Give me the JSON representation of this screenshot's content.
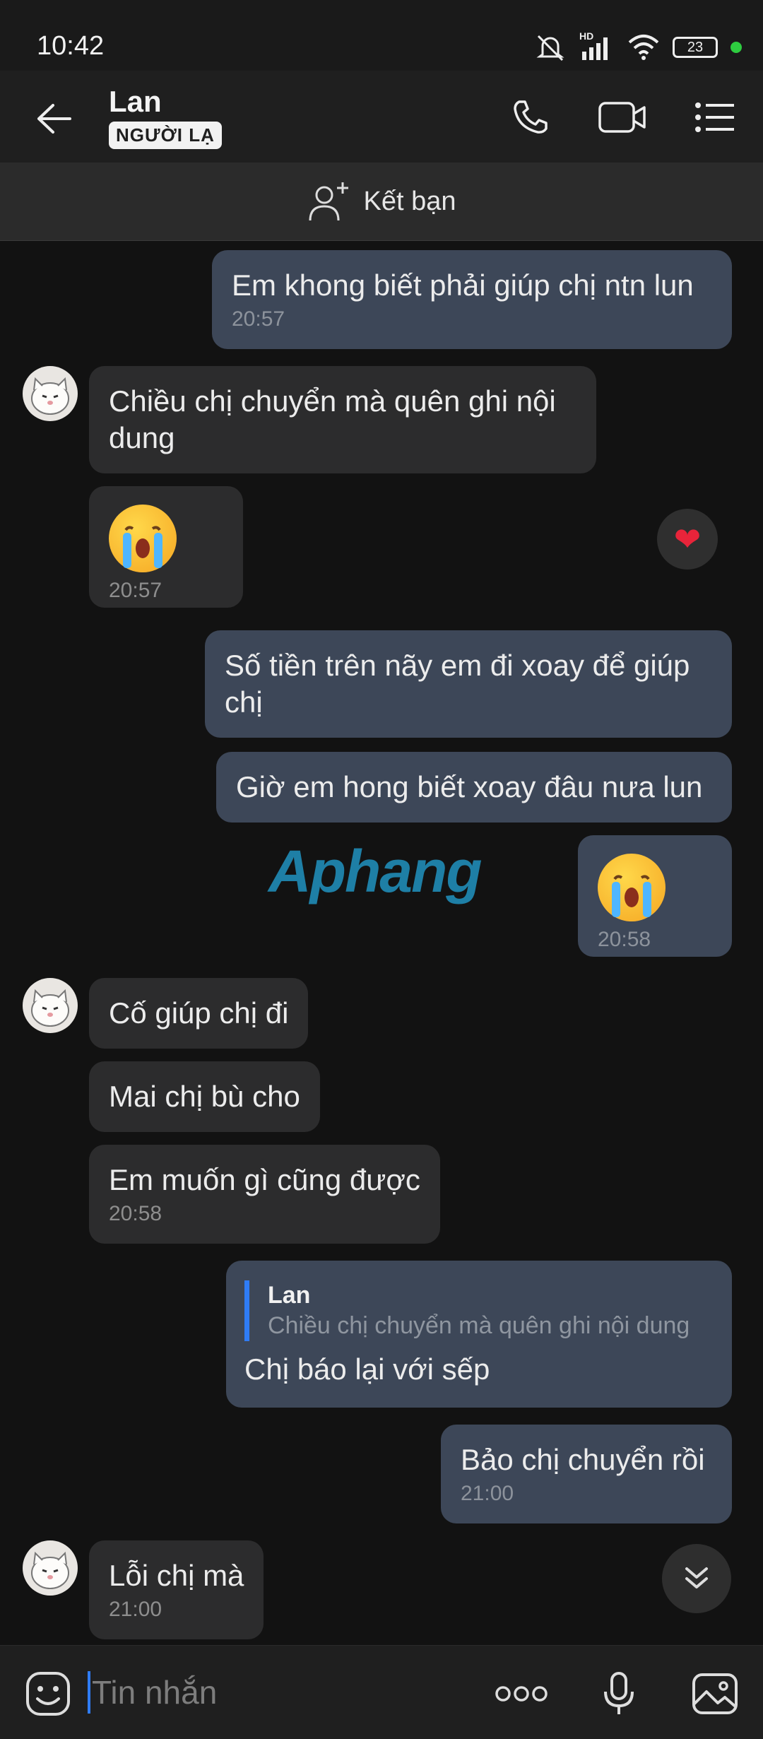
{
  "status_bar": {
    "time": "10:42",
    "network": "HD",
    "battery": "23"
  },
  "header": {
    "name": "Lan",
    "badge": "NGƯỜI LẠ"
  },
  "friend_bar": {
    "label": "Kết bạn"
  },
  "watermark": {
    "text": "Aphang"
  },
  "messages": {
    "m1": {
      "text": "Em khong biết phải giúp chị ntn lun",
      "time": "20:57"
    },
    "m2": {
      "text": "Chiều chị chuyển mà quên ghi nội dung"
    },
    "m3": {
      "time": "20:57",
      "reaction": "❤"
    },
    "m4": {
      "text": "Số tiền trên nãy em đi xoay để giúp chị"
    },
    "m5": {
      "text": "Giờ em hong biết xoay đâu nưa lun"
    },
    "m6": {
      "time": "20:58"
    },
    "m7": {
      "text": "Cố giúp chị đi"
    },
    "m8": {
      "text": "Mai chị bù cho"
    },
    "m9": {
      "text": "Em muốn gì cũng được",
      "time": "20:58"
    },
    "m10": {
      "quote_name": "Lan",
      "quote_text": "Chiều chị chuyển mà quên ghi nội dung",
      "text": "Chị báo lại với sếp"
    },
    "m11": {
      "text": "Bảo chị chuyển rồi",
      "time": "21:00"
    },
    "m12": {
      "text": "Lỗi chị mà",
      "time": "21:00"
    }
  },
  "composer": {
    "placeholder": "Tin nhắn"
  },
  "colors": {
    "accent": "#2f7cf6",
    "sent_bubble": "#3d4758",
    "received_bubble": "#2c2c2d"
  }
}
